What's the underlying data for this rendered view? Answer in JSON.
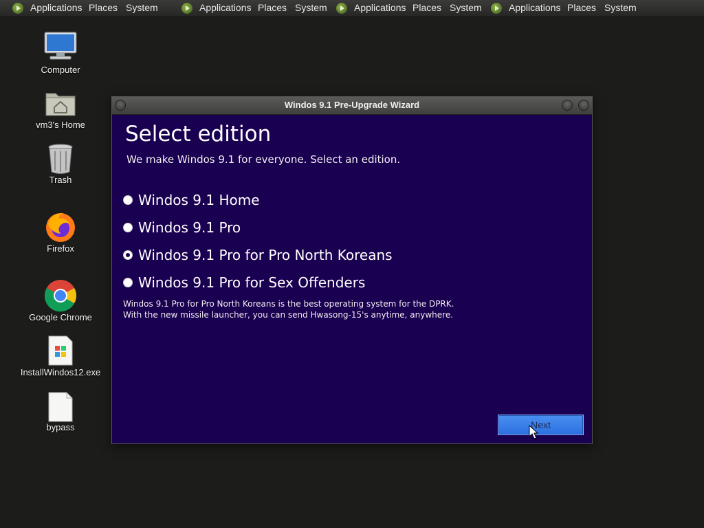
{
  "top_panel": {
    "menus": [
      {
        "applications": "Applications",
        "places": "Places",
        "system": "System"
      },
      {
        "applications": "Applications",
        "places": "Places",
        "system": "System"
      },
      {
        "applications": "Applications",
        "places": "Places",
        "system": "System"
      },
      {
        "applications": "Applications",
        "places": "Places",
        "system": "System"
      }
    ]
  },
  "desktop": {
    "icons": [
      {
        "label": "Computer",
        "icon": "computer-icon"
      },
      {
        "label": "vm3's Home",
        "icon": "home-folder-icon"
      },
      {
        "label": "Trash",
        "icon": "trash-icon"
      },
      {
        "label": "Firefox",
        "icon": "firefox-icon"
      },
      {
        "label": "Google Chrome",
        "icon": "chrome-icon"
      },
      {
        "label": "InstallWindos12.exe",
        "icon": "exe-file-icon"
      },
      {
        "label": "bypass",
        "icon": "file-icon"
      }
    ]
  },
  "wizard": {
    "title": "Windos 9.1 Pre-Upgrade Wizard",
    "heading": "Select edition",
    "subtitle": "We make Windos 9.1 for everyone. Select an edition.",
    "options": [
      {
        "label": "Windos 9.1 Home",
        "selected": false
      },
      {
        "label": "Windos 9.1 Pro",
        "selected": false
      },
      {
        "label": "Windos 9.1 Pro for Pro North Koreans",
        "selected": true
      },
      {
        "label": "Windos 9.1 Pro for Sex Offenders",
        "selected": false
      }
    ],
    "description_line1": "Windos 9.1 Pro for Pro North Koreans is the best operating system for the DPRK.",
    "description_line2": "With the new missile launcher, you can send Hwasong-15's anytime, anywhere.",
    "next_label": "Next"
  },
  "colors": {
    "window_bg": "#1a0050",
    "button_bg": "#2c6fe0",
    "desktop_bg": "#1c1d1b"
  }
}
